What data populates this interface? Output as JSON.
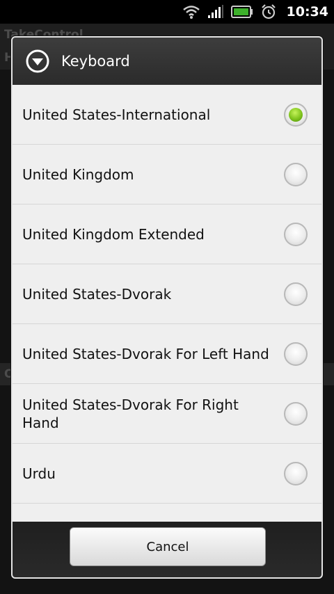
{
  "status_bar": {
    "time": "10:34",
    "icons": [
      "wifi-icon",
      "signal-icon",
      "battery-icon",
      "alarm-icon"
    ]
  },
  "background": {
    "app_title": "TakeControl",
    "header_initial": "H",
    "section_initial": "O"
  },
  "dialog": {
    "title": "Keyboard",
    "icon": "chevron-down-circle-icon",
    "options": [
      {
        "label": "United States-International",
        "selected": true
      },
      {
        "label": "United Kingdom",
        "selected": false
      },
      {
        "label": "United Kingdom Extended",
        "selected": false
      },
      {
        "label": "United States-Dvorak",
        "selected": false
      },
      {
        "label": "United States-Dvorak For Left Hand",
        "selected": false
      },
      {
        "label": "United States-Dvorak For Right Hand",
        "selected": false
      },
      {
        "label": "Urdu",
        "selected": false
      },
      {
        "label": "",
        "selected": false
      }
    ],
    "cancel_label": "Cancel"
  },
  "colors": {
    "accent_selected": "#7fc31d",
    "dialog_header": "#2b2b2b",
    "dialog_body": "#efefef"
  }
}
